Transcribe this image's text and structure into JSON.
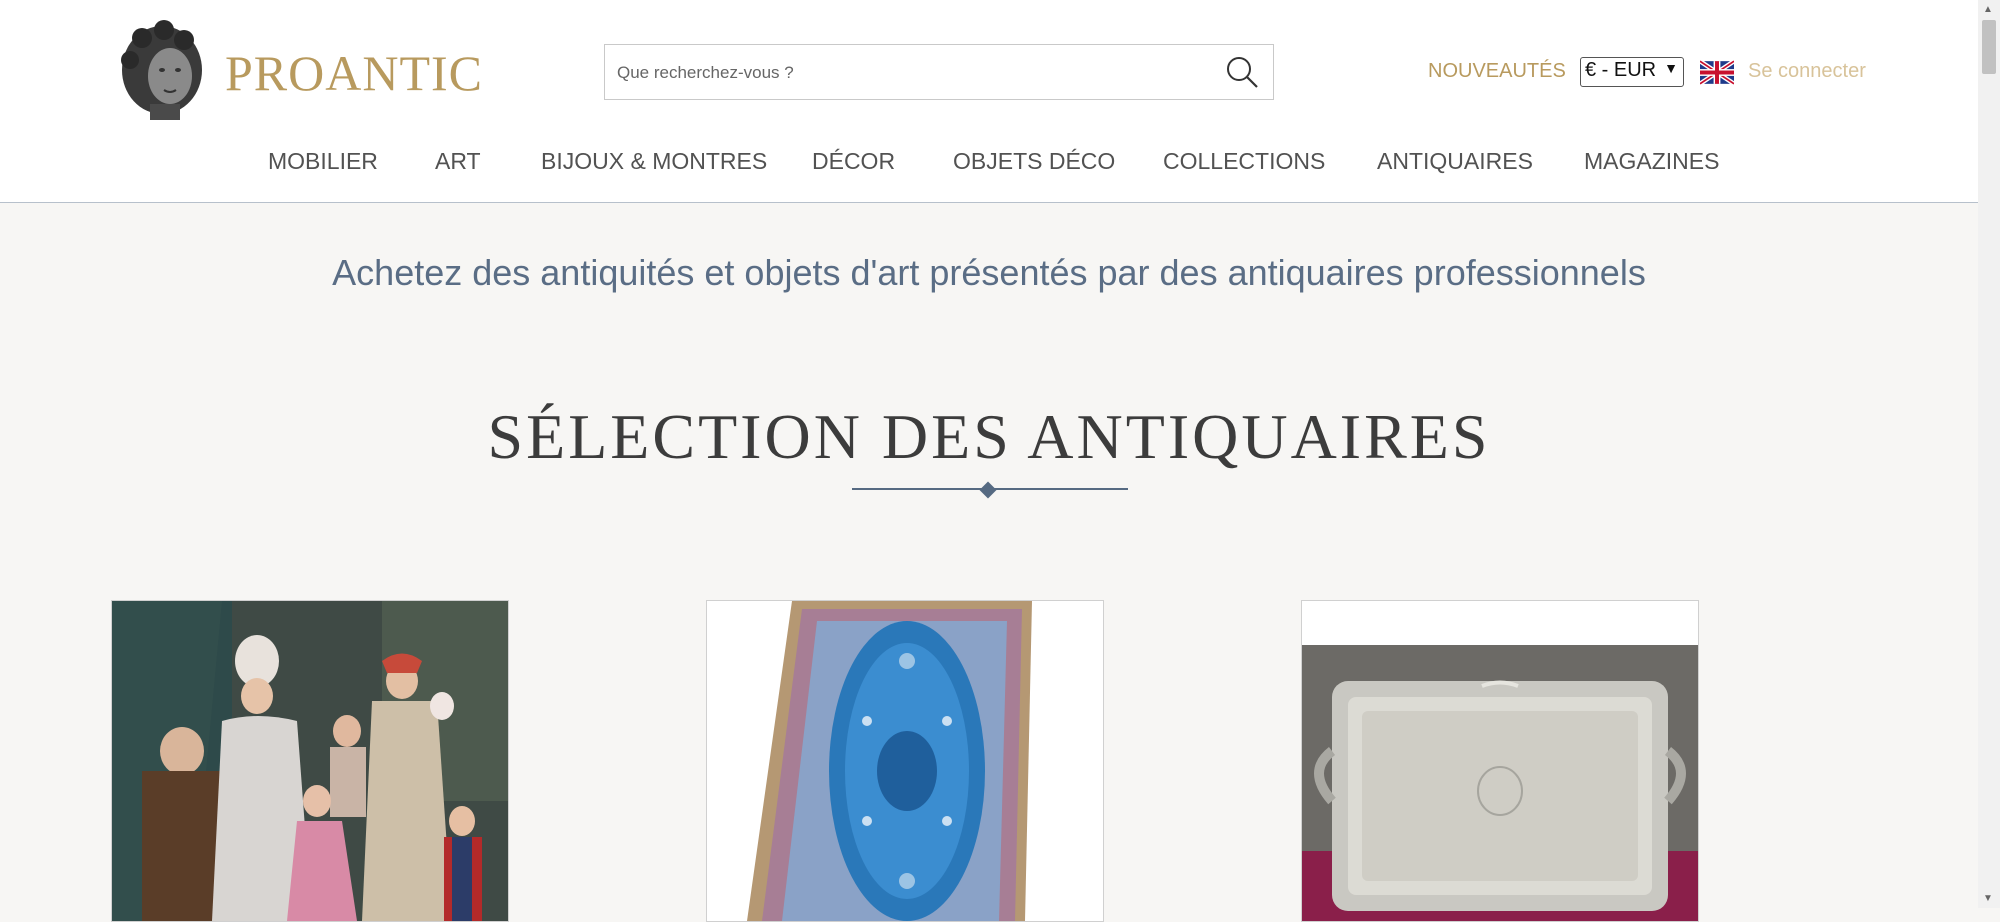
{
  "header": {
    "logo_text": "PROANTIC",
    "search": {
      "placeholder": "Que recherchez-vous ?",
      "value": ""
    },
    "nouveautes_label": "NOUVEAUTÉS",
    "currency": {
      "selected": "€ - EUR"
    },
    "language_flag": "uk-flag-icon",
    "connect_label": "Se connecter"
  },
  "nav": {
    "items": [
      {
        "label": "MOBILIER"
      },
      {
        "label": "ART"
      },
      {
        "label": "BIJOUX & MONTRES"
      },
      {
        "label": "DÉCOR"
      },
      {
        "label": "OBJETS DÉCO"
      },
      {
        "label": "COLLECTIONS"
      },
      {
        "label": "ANTIQUAIRES"
      },
      {
        "label": "MAGAZINES"
      }
    ]
  },
  "main": {
    "tagline": "Achetez des antiquités et objets d'art présentés par des antiquaires professionnels",
    "section_title": "SÉLECTION DES ANTIQUAIRES",
    "cards": [
      {
        "image": "family-painting-image"
      },
      {
        "image": "blue-silk-rug-image"
      },
      {
        "image": "silver-tray-image"
      }
    ]
  },
  "colors": {
    "brand_gold": "#b89a5e",
    "accent_blue": "#566a82",
    "background": "#f7f6f4"
  }
}
